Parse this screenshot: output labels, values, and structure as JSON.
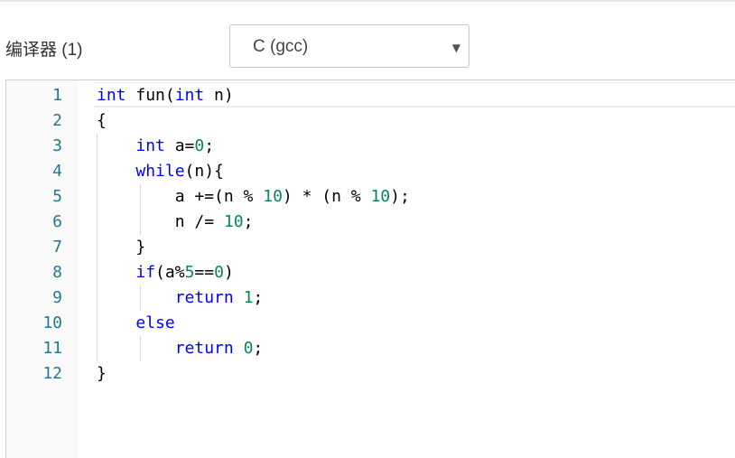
{
  "toolbar": {
    "compiler_label": "编译器 (1)",
    "compiler_select": {
      "value": "C (gcc)",
      "arrow_icon": "triangle-down-icon"
    }
  },
  "editor": {
    "lines": [
      {
        "number": "1",
        "tokens": [
          {
            "t": "int",
            "c": "kw"
          },
          {
            "t": " fun(",
            "c": "plain"
          },
          {
            "t": "int",
            "c": "kw"
          },
          {
            "t": " n)",
            "c": "plain"
          }
        ]
      },
      {
        "number": "2",
        "tokens": [
          {
            "t": "{",
            "c": "plain"
          }
        ]
      },
      {
        "number": "3",
        "tokens": [
          {
            "t": "    ",
            "c": "plain"
          },
          {
            "t": "int",
            "c": "kw"
          },
          {
            "t": " a=",
            "c": "plain"
          },
          {
            "t": "0",
            "c": "num"
          },
          {
            "t": ";",
            "c": "plain"
          }
        ]
      },
      {
        "number": "4",
        "tokens": [
          {
            "t": "    ",
            "c": "plain"
          },
          {
            "t": "while",
            "c": "kw"
          },
          {
            "t": "(n){",
            "c": "plain"
          }
        ]
      },
      {
        "number": "5",
        "tokens": [
          {
            "t": "        a +=(n % ",
            "c": "plain"
          },
          {
            "t": "10",
            "c": "num"
          },
          {
            "t": ") * (n % ",
            "c": "plain"
          },
          {
            "t": "10",
            "c": "num"
          },
          {
            "t": ");",
            "c": "plain"
          }
        ]
      },
      {
        "number": "6",
        "tokens": [
          {
            "t": "        n /= ",
            "c": "plain"
          },
          {
            "t": "10",
            "c": "num"
          },
          {
            "t": ";",
            "c": "plain"
          }
        ]
      },
      {
        "number": "7",
        "tokens": [
          {
            "t": "    }",
            "c": "plain"
          }
        ]
      },
      {
        "number": "8",
        "tokens": [
          {
            "t": "    ",
            "c": "plain"
          },
          {
            "t": "if",
            "c": "kw"
          },
          {
            "t": "(a%",
            "c": "plain"
          },
          {
            "t": "5",
            "c": "num"
          },
          {
            "t": "==",
            "c": "plain"
          },
          {
            "t": "0",
            "c": "num"
          },
          {
            "t": ")",
            "c": "plain"
          }
        ]
      },
      {
        "number": "9",
        "tokens": [
          {
            "t": "        ",
            "c": "plain"
          },
          {
            "t": "return",
            "c": "kw"
          },
          {
            "t": " ",
            "c": "plain"
          },
          {
            "t": "1",
            "c": "num"
          },
          {
            "t": ";",
            "c": "plain"
          }
        ]
      },
      {
        "number": "10",
        "tokens": [
          {
            "t": "    ",
            "c": "plain"
          },
          {
            "t": "else",
            "c": "kw"
          }
        ]
      },
      {
        "number": "11",
        "tokens": [
          {
            "t": "        ",
            "c": "plain"
          },
          {
            "t": "return",
            "c": "kw"
          },
          {
            "t": " ",
            "c": "plain"
          },
          {
            "t": "0",
            "c": "num"
          },
          {
            "t": ";",
            "c": "plain"
          }
        ]
      },
      {
        "number": "12",
        "tokens": [
          {
            "t": "}",
            "c": "plain"
          }
        ]
      }
    ]
  },
  "colors": {
    "keyword": "#0000ff",
    "number": "#098658",
    "line_number": "#237893"
  }
}
